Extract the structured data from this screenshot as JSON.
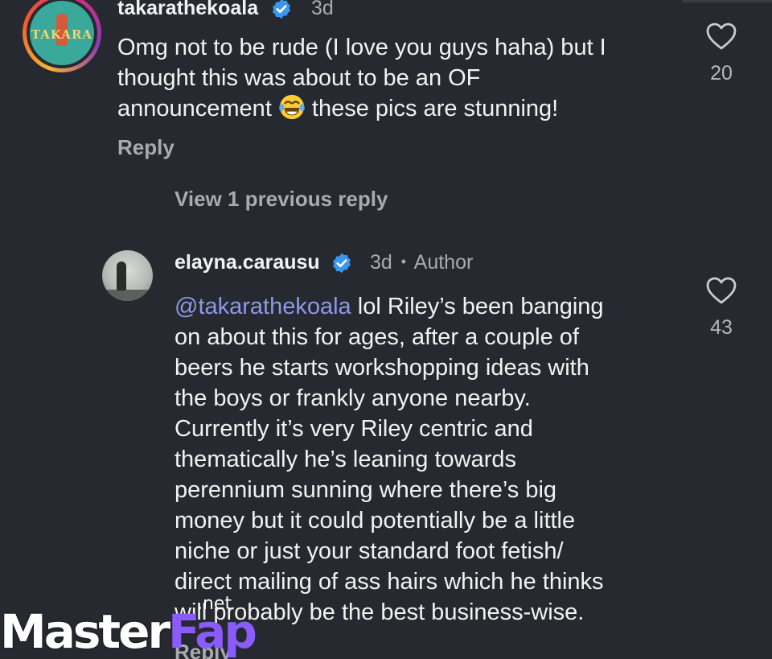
{
  "comments": [
    {
      "username": "takarathekoala",
      "time": "3d",
      "avatar_text": "TAKARA",
      "text_lines": [
        "Omg not to be rude (I love you guys haha) but I",
        "thought this was about to be an OF",
        "announcement",
        " these pics are stunning!"
      ],
      "emoji": "face-with-tears-of-joy",
      "reply_label": "Reply",
      "likes": "20"
    }
  ],
  "view_previous_label": "View 1 previous reply",
  "reply": {
    "username": "elayna.carausu",
    "time": "3d",
    "separator": "•",
    "author_label": "Author",
    "mention": "@takarathekoala",
    "text_first_line_rest": " lol Riley’s been banging",
    "text_lines": [
      "on about this for ages, after a couple of",
      "beers he starts workshopping ideas with",
      "the boys or frankly anyone nearby.",
      "Currently it’s very Riley centric and",
      "thematically he’s leaning towards",
      "perennium sunning where there’s big",
      "money but it could potentially be a little",
      "niche or just your standard foot fetish/",
      "direct mailing of ass hairs which he thinks",
      "will probably be the best business-wise."
    ],
    "reply_label": "Reply",
    "likes": "43"
  },
  "watermark": {
    "part1": "Master",
    "part2": "Fap",
    "suffix": ".net"
  },
  "icons": {
    "verified": "verified-badge-icon",
    "like": "heart-outline-icon"
  },
  "colors": {
    "background": "#262a30",
    "mention": "#8e98e8",
    "verified": "#3897f0",
    "secondary_text": "#a8acb1"
  }
}
